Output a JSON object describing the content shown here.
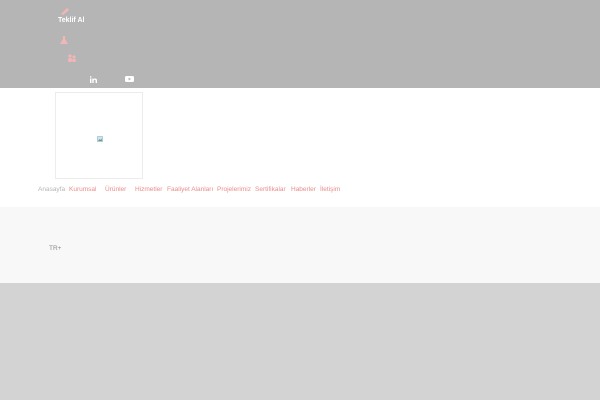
{
  "topbar": {
    "quote_label": "Teklif Al",
    "icons": [
      "pencil-icon",
      "flask-icon",
      "people-icon"
    ],
    "social": [
      "linkedin-icon",
      "youtube-icon"
    ]
  },
  "nav": {
    "items": [
      {
        "label": "Anasayfa"
      },
      {
        "label": "Kurumsal"
      },
      {
        "label": "Ürünler"
      },
      {
        "label": "Hizmetler"
      },
      {
        "label": "Faaliyet Alanları"
      },
      {
        "label": "Projelerimiz"
      },
      {
        "label": "Sertifikalar"
      },
      {
        "label": "Haberler"
      },
      {
        "label": "İletişim"
      }
    ]
  },
  "language": {
    "label": "TR+"
  },
  "colors": {
    "accent": "#ea8c8c",
    "topbar": "#b5b5b5",
    "strip": "#f8f8f8",
    "page_bg": "#d3d3d3"
  }
}
